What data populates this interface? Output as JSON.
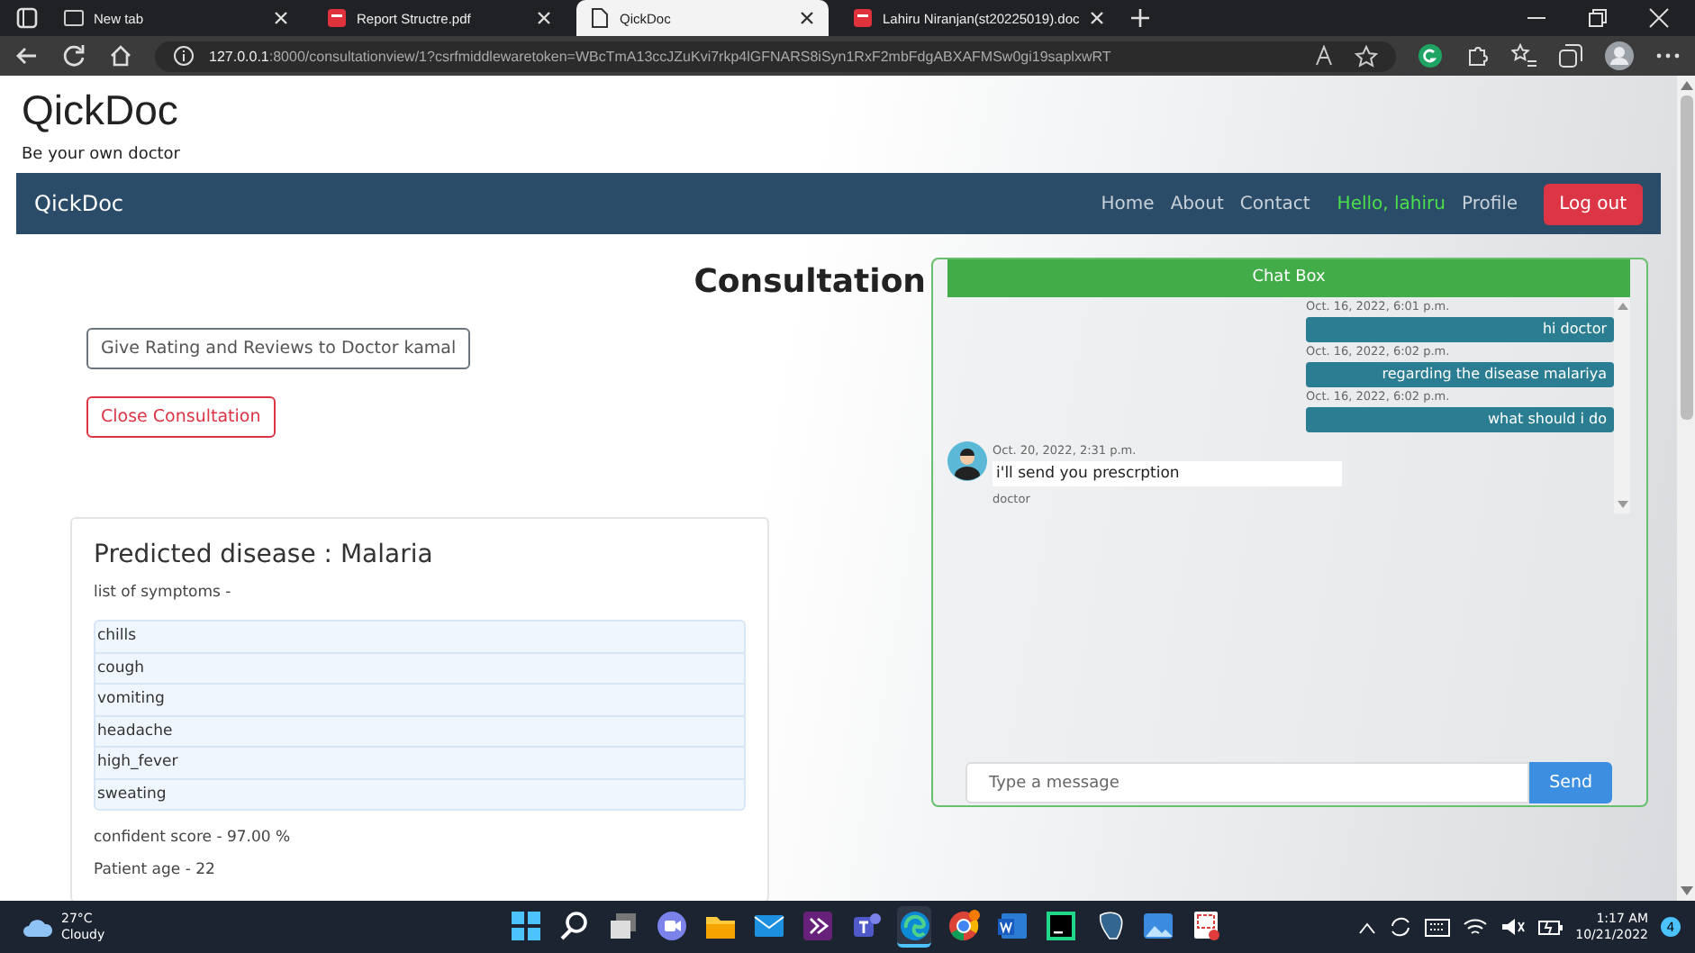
{
  "browser": {
    "tabs": [
      {
        "title": "New tab",
        "kind": "blank",
        "selected": false
      },
      {
        "title": "Report Structre.pdf",
        "kind": "pdf",
        "selected": false
      },
      {
        "title": "QickDoc",
        "kind": "page",
        "selected": true
      },
      {
        "title": "Lahiru Niranjan(st20225019).doc",
        "kind": "pdf",
        "selected": false
      }
    ],
    "address_host": "127.0.0.1",
    "address_rest": ":8000/consultationview/1?csrfmiddlewaretoken=WBcTmA13ccJZuKvi7rkp4lGFNARS8iSyn1RxF2mbFdgABXAFMSw0gi19saplxwRT"
  },
  "page": {
    "brand": "QickDoc",
    "tagline": "Be your own doctor",
    "navbar": {
      "brand": "QickDoc",
      "links": [
        {
          "label": "Home",
          "kind": "link"
        },
        {
          "label": "About",
          "kind": "link"
        },
        {
          "label": "Contact",
          "kind": "link"
        },
        {
          "label": "Hello, lahiru",
          "kind": "greeting"
        },
        {
          "label": "Profile",
          "kind": "link"
        },
        {
          "label": "Log out",
          "kind": "button"
        }
      ]
    },
    "heading": "Consultation",
    "actions": [
      {
        "label": "Give Rating and Reviews to Doctor kamal",
        "kind": "secondary"
      },
      {
        "label": "Close Consultation",
        "kind": "danger"
      }
    ],
    "card": {
      "title": "Predicted disease : Malaria",
      "symptoms_label": "list of symptoms -",
      "symptoms": [
        "chills",
        "cough",
        "vomiting",
        "headache",
        "high_fever",
        "sweating"
      ],
      "score": "confident score - 97.00 %",
      "age": "Patient age - 22"
    },
    "chat": {
      "title": "Chat Box",
      "messages": [
        {
          "kind": "sent",
          "time": "Oct. 16, 2022, 6:01 p.m.",
          "text": "hi doctor"
        },
        {
          "kind": "sent",
          "time": "Oct. 16, 2022, 6:02 p.m.",
          "text": "regarding the disease malariya"
        },
        {
          "kind": "sent",
          "time": "Oct. 16, 2022, 6:02 p.m.",
          "text": "what should i do"
        },
        {
          "kind": "received",
          "time": "Oct. 20, 2022, 2:31 p.m.",
          "text": "i'll send you prescrption",
          "sender": "doctor"
        }
      ],
      "input": {
        "placeholder": "Type a message"
      },
      "send": "Send"
    }
  },
  "taskbar": {
    "temperature": "27°C",
    "weather": "Cloudy",
    "apps": [
      {
        "kind": "start"
      },
      {
        "kind": "search"
      },
      {
        "kind": "taskview"
      },
      {
        "kind": "chat"
      },
      {
        "kind": "folder"
      },
      {
        "kind": "mail"
      },
      {
        "kind": "vs"
      },
      {
        "kind": "teams"
      },
      {
        "kind": "edge",
        "selected": true
      },
      {
        "kind": "chrome",
        "selected": false
      },
      {
        "kind": "word",
        "selected": false
      },
      {
        "kind": "pycharm",
        "selected": false
      },
      {
        "kind": "postgres",
        "selected": false
      },
      {
        "kind": "photos",
        "selected": false
      },
      {
        "kind": "snip",
        "selected": false
      }
    ],
    "time": "1:17 AM",
    "date": "10/21/2022",
    "notifications": "4"
  }
}
